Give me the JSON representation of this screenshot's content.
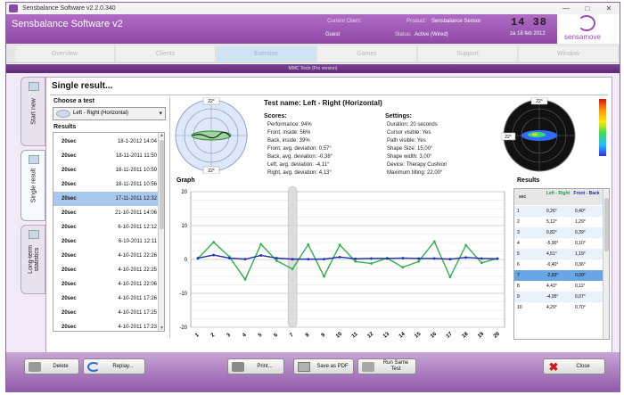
{
  "window": {
    "title": "Sensbalance Software v2.2.0.340",
    "controls": [
      "—",
      "□",
      "✕"
    ]
  },
  "header": {
    "app_title": "Sensbalance Software v2",
    "current_client_label": "Current Client:",
    "client_name": "Guest",
    "product_label": "Product:",
    "product_value": "Sensbalance Sensor",
    "status_label": "Status:",
    "status_value": "Active (Wired)",
    "clock": "14 38",
    "date": "za 18 feb 2012",
    "logo_text": "sensamove"
  },
  "nav": {
    "tabs": [
      "Overview",
      "Clients",
      "Exercise",
      "Games",
      "Support",
      "Window"
    ],
    "active": "Exercise"
  },
  "mmc_title": "MMC Tests (Pro version)",
  "side_tabs": [
    "Start new",
    "Single result",
    "Long-term statistics"
  ],
  "panel": {
    "title": "Single result...",
    "choose_label": "Choose a test",
    "selected_test": "Left - Right (Horizontal)",
    "results_label": "Results",
    "list": [
      [
        "20sec",
        "18-1-2012 14:04"
      ],
      [
        "20sec",
        "18-11-2011 11:50"
      ],
      [
        "20sec",
        "18-11-2011 10:59"
      ],
      [
        "20sec",
        "18-11-2011 10:56"
      ],
      [
        "20sec",
        "17-11-2011 12:32"
      ],
      [
        "20sec",
        "21-10-2011 14:06"
      ],
      [
        "20sec",
        "6-10-2011 12:12"
      ],
      [
        "20sec",
        "6-10-2011 12:11"
      ],
      [
        "20sec",
        "4-10-2011 22:26"
      ],
      [
        "20sec",
        "4-10-2011 22:25"
      ],
      [
        "20sec",
        "4-10-2011 22:06"
      ],
      [
        "20sec",
        "4-10-2011 17:26"
      ],
      [
        "20sec",
        "4-10-2011 17:25"
      ],
      [
        "20sec",
        "4-10-2011 17:23"
      ]
    ],
    "selected_index": 4,
    "test_name": "Test name: Left - Right (Horizontal)",
    "scores_label": "Scores:",
    "scores": [
      "Performance: 94%",
      "Front, inside: 56%",
      "Back, inside: 39%",
      "Front, avg. deviation: 0,57°",
      "Back, avg. deviation: -0,38°",
      "Left, avg. deviation: -4,11°",
      "Right, avg. deviation: 4,13°"
    ],
    "settings_label": "Settings:",
    "settings": [
      "Duration: 20 seconds",
      "Cursor visible: Yes",
      "Path visible: Yes",
      "Shape Size: 15,00°",
      "Shape width: 3,00°",
      "Device: Therapy Cushion",
      "Maximum tilting: 22,00°"
    ],
    "target_labels": [
      "22°",
      "22°",
      "22°",
      "22°"
    ],
    "graph_label": "Graph",
    "results_table_label": "Results",
    "table_headers": [
      "sec",
      "Left - Right",
      "Front - Back"
    ],
    "table_rows": [
      [
        "1",
        "0,26°",
        "0,40°"
      ],
      [
        "2",
        "5,12°",
        "1,29°"
      ],
      [
        "3",
        "0,82°",
        "0,39°"
      ],
      [
        "4",
        "-5,90°",
        "0,10°"
      ],
      [
        "5",
        "4,51°",
        "1,19°"
      ],
      [
        "6",
        "-0,40°",
        "0,36°"
      ],
      [
        "7",
        "-2,83°",
        "0,09°"
      ],
      [
        "8",
        "4,43°",
        "0,11°"
      ],
      [
        "9",
        "-4,95°",
        "0,07°"
      ],
      [
        "10",
        "4,29°",
        "0,70°"
      ]
    ],
    "selected_table_row": 6
  },
  "chart_data": {
    "type": "line",
    "title": "Graph",
    "x": [
      1,
      2,
      3,
      4,
      5,
      6,
      7,
      8,
      9,
      10,
      11,
      12,
      13,
      14,
      15,
      16,
      17,
      18,
      19,
      20
    ],
    "ylim": [
      -20,
      20
    ],
    "yticks": [
      20,
      10,
      0,
      -10,
      -20
    ],
    "series": [
      {
        "values": [
          0.3,
          5.1,
          0.8,
          -5.9,
          4.5,
          -0.4,
          -2.8,
          4.4,
          -5.0,
          4.3,
          -0.6,
          -1.2,
          0.4,
          -2.3,
          -0.6,
          5.3,
          -5.2,
          4.2,
          -1.0,
          0.3
        ]
      },
      {
        "values": [
          0.4,
          1.3,
          0.4,
          0.1,
          1.2,
          0.4,
          0.1,
          0.1,
          0.1,
          0.7,
          0.2,
          0.3,
          0.3,
          0.4,
          0.3,
          0.3,
          0.1,
          0.6,
          0.3,
          0.2
        ]
      }
    ],
    "colors": [
      "#2fb04a",
      "#1f2fa8"
    ],
    "highlight_x": 7,
    "grid": true
  },
  "bottom": {
    "delete": "Delete",
    "replay": "Replay...",
    "print": "Print...",
    "save_pdf": "Save as PDF",
    "run_same_1": "Run Same",
    "run_same_2": "Test",
    "close": "Close"
  }
}
